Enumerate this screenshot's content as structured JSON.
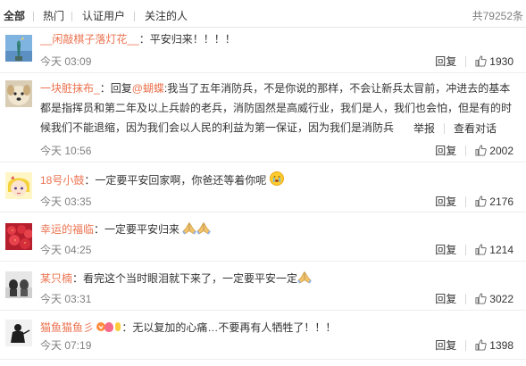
{
  "tabs": [
    {
      "label": "全部",
      "active": true
    },
    {
      "label": "热门",
      "active": false
    },
    {
      "label": "认证用户",
      "active": false
    },
    {
      "label": "关注的人",
      "active": false
    }
  ],
  "total_label": "共79252条",
  "actions": {
    "report": "举报",
    "delete": "回复",
    "reply": "回复"
  },
  "comments": [
    {
      "user": "__闲敲棋子落灯花__",
      "text": "：平安归来！！！！",
      "time": "今天 03:09",
      "likes": "1930",
      "avatar_icon": "statue-of-liberty-avatar"
    },
    {
      "user": "一块脏抹布_",
      "pre": "：回复",
      "mention": "@蝴蝶",
      "text": ":我当了五年消防兵，不是你说的那样，不会让新兵太冒前，冲进去的基本都是指挥员和第二年及以上兵龄的老兵，消防固然是高威行业，我们是人，我们也会怕，但是有的时候我们不能退缩，因为我们会以人民的利益为第一保证，因为我们是消防兵",
      "time": "今天 10:56",
      "likes": "2002",
      "report": "举报",
      "convo": "查看对话",
      "avatar_icon": "dog-avatar"
    },
    {
      "user": "18号小鼓",
      "text": "：一定要平安回家啊，你爸还等着你呢",
      "emoji": "crying-emoji",
      "time": "今天 03:35",
      "likes": "2176",
      "avatar_icon": "anime-avatar"
    },
    {
      "user": "幸运的福临",
      "text": "：一定要平安归来",
      "emoji": "praying-hands-emoji",
      "time": "今天 04:25",
      "likes": "1214",
      "avatar_icon": "strawberries-avatar"
    },
    {
      "user": "某只楠",
      "text": "：看完这个当时眼泪就下来了，一定要平安一定",
      "emoji": "praying-hands-emoji",
      "time": "今天 03:31",
      "likes": "3022",
      "avatar_icon": "photo-avatar"
    },
    {
      "user": "猫鱼猫鱼彡",
      "text": "：无以复加的心痛…不要再有人牺牲了！！！",
      "badges": "vip-badges",
      "time": "今天 07:19",
      "likes": "1398",
      "avatar_icon": "silhouette-avatar"
    }
  ],
  "colors": {
    "username": "#eb7350",
    "meta": "#808080",
    "text": "#333333",
    "border": "#eeeeee"
  }
}
